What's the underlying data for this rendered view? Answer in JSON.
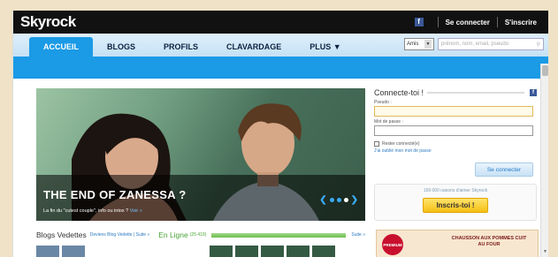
{
  "header": {
    "logo": "Skyrock",
    "facebook_icon": "f",
    "login_link": "Se connecter",
    "signup_link": "S'inscrire"
  },
  "nav": {
    "tabs": [
      {
        "label": "ACCUEIL"
      },
      {
        "label": "BLOGS"
      },
      {
        "label": "PROFILS"
      },
      {
        "label": "CLAVARDAGE"
      },
      {
        "label": "PLUS ▼"
      }
    ],
    "search": {
      "select_value": "Amis",
      "placeholder": "prénom, nom, email, pseudo"
    }
  },
  "hero": {
    "title": "THE END OF ZANESSA ?",
    "subtitle": "La fin du \"cutest couple\", info ou intox ?",
    "more": "Voir »"
  },
  "login": {
    "title": "Connecte-toi !",
    "pseudo_label": "Pseudo :",
    "password_label": "Mot de passe :",
    "remember_label": "Rester connecté(e)",
    "forgot_label": "J'ai oublié mon mot de passe",
    "connect_button": "Se connecter",
    "signup_note": "169 000 raisons d'aimer Skyrock",
    "signup_button": "Inscris-toi !"
  },
  "sections": {
    "blogs_title": "Blogs Vedettes",
    "blogs_link": "Deviens Blog Vedette | Suite »",
    "online_title": "En Ligne",
    "online_count": "(25 419)",
    "online_link": "Suite »"
  },
  "ad": {
    "badge": "PREMIUM",
    "text": "CHAUSSON AUX POMMES CUIT AU FOUR"
  },
  "colors": {
    "accent": "#1b9ae6",
    "green": "#4aa534",
    "signup_yellow": "#f5bf14"
  }
}
